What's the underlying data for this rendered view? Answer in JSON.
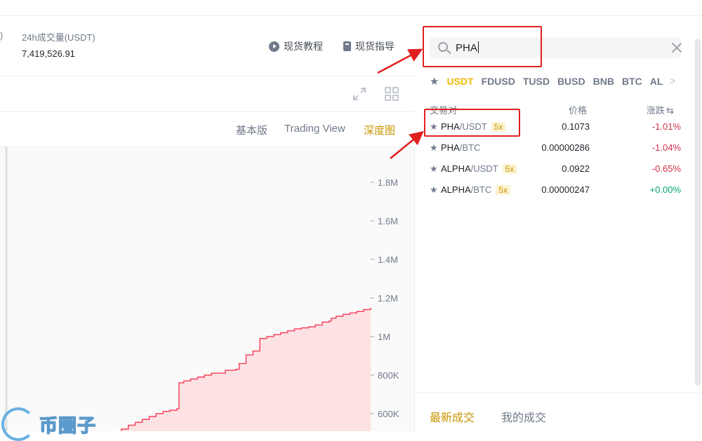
{
  "header": {
    "paren": ")",
    "volume_label": "24h成交量(USDT)",
    "volume_value": "7,419,526.91",
    "tutorial_label": "现货教程",
    "guide_label": "现货指导"
  },
  "chart_views": [
    "基本版",
    "Trading View",
    "深度图"
  ],
  "active_view": "深度图",
  "chart_data": {
    "type": "area",
    "title": "",
    "y_tick_labels": [
      "1.8M",
      "1.6M",
      "1.4M",
      "1.2M",
      "1M",
      "800K",
      "600K"
    ],
    "ylim": [
      500000,
      1900000
    ],
    "series": [
      {
        "side": "asks",
        "color": "#f6465d",
        "fill": "#fde2e4",
        "x": [
          0,
          7,
          8,
          9,
          10,
          11,
          12,
          13,
          14,
          15,
          15.3,
          16,
          17,
          18,
          19,
          20,
          22,
          23.5,
          24,
          25,
          26,
          27,
          28,
          29,
          30,
          31,
          32,
          33,
          34,
          35,
          36,
          37,
          37.3,
          38,
          39,
          40,
          41,
          42,
          43
        ],
        "values": [
          500000,
          520000,
          540000,
          555000,
          570000,
          585000,
          600000,
          612000,
          618000,
          625000,
          760000,
          770000,
          780000,
          790000,
          800000,
          810000,
          825000,
          830000,
          860000,
          905000,
          925000,
          990000,
          1000000,
          1010000,
          1020000,
          1030000,
          1040000,
          1045000,
          1050000,
          1060000,
          1075000,
          1080000,
          1095000,
          1105000,
          1115000,
          1122000,
          1130000,
          1140000,
          1150000
        ]
      }
    ]
  },
  "search": {
    "value": "PHA"
  },
  "quote_tabs": [
    "USDT",
    "FDUSD",
    "TUSD",
    "BUSD",
    "BNB",
    "BTC",
    "AL"
  ],
  "active_quote": "USDT",
  "table_headers": {
    "pair": "交易对",
    "price": "价格",
    "change": "涨跌"
  },
  "pairs": [
    {
      "base": "PHA",
      "quote": "/USDT",
      "leverage": "5x",
      "price": "0.1073",
      "change": "-1.01%",
      "dir": "neg"
    },
    {
      "base": "PHA",
      "quote": "/BTC",
      "leverage": "",
      "price": "0.00000286",
      "change": "-1.04%",
      "dir": "neg"
    },
    {
      "base": "ALPHA",
      "quote": "/USDT",
      "leverage": "5x",
      "price": "0.0922",
      "change": "-0.65%",
      "dir": "neg"
    },
    {
      "base": "ALPHA",
      "quote": "/BTC",
      "leverage": "5x",
      "price": "0.00000247",
      "change": "+0.00%",
      "dir": "pos"
    }
  ],
  "trade_tabs": [
    "最新成交",
    "我的成交"
  ],
  "active_trade_tab": "最新成交",
  "watermark": "币圈子",
  "colors": {
    "accent": "#f0b90b",
    "negative": "#cf304a",
    "positive": "#03a66d",
    "highlight": "#e02020"
  }
}
